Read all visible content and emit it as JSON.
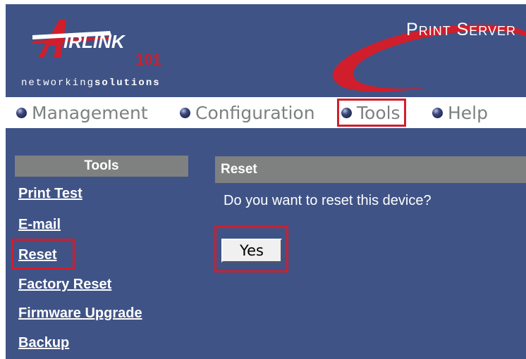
{
  "header": {
    "product_title": "Print Server",
    "tagline_light": "networking",
    "tagline_bold": "solutions",
    "logo_text_main": "IRLINK",
    "logo_text_num": "101",
    "accent_color": "#d11e2c"
  },
  "nav": {
    "items": [
      {
        "label": "Management",
        "icon": "bullet-icon"
      },
      {
        "label": "Configuration",
        "icon": "bullet-icon"
      },
      {
        "label": "Tools",
        "icon": "bullet-icon"
      },
      {
        "label": "Help",
        "icon": "bullet-icon"
      }
    ]
  },
  "sidebar": {
    "header": "Tools",
    "links": [
      "Print Test",
      "E-mail",
      "Reset",
      "Factory Reset",
      "Firmware Upgrade",
      "Backup"
    ]
  },
  "main": {
    "header": "Reset",
    "prompt": "Do you want to reset this device?",
    "yes_label": "Yes"
  }
}
